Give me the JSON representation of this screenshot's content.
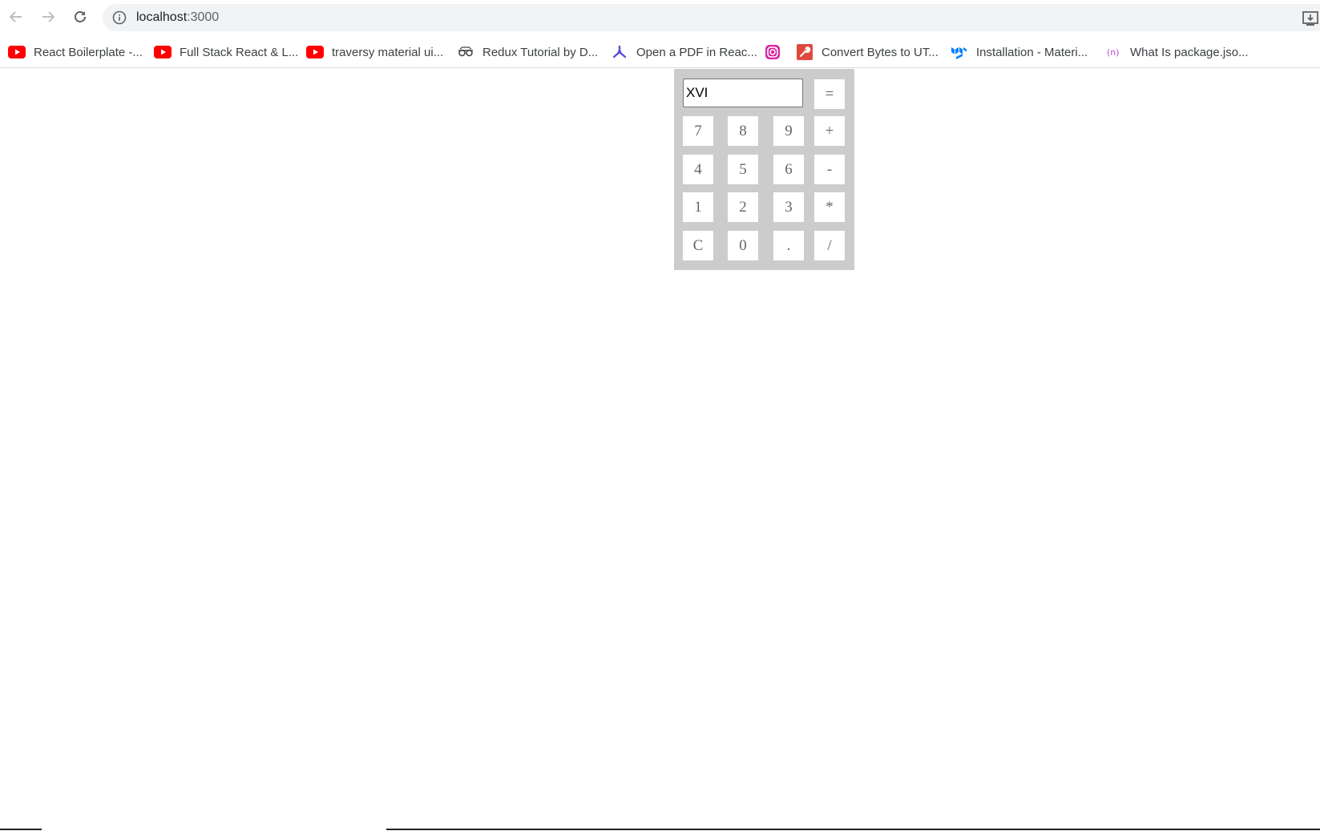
{
  "browser": {
    "url_host": "localhost",
    "url_port": ":3000",
    "bookmarks": [
      {
        "label": "React Boilerplate -...",
        "icon": "youtube-icon"
      },
      {
        "label": "Full Stack React & L...",
        "icon": "youtube-icon"
      },
      {
        "label": "traversy material ui...",
        "icon": "youtube-icon"
      },
      {
        "label": "Redux Tutorial by D...",
        "icon": "glasses-icon"
      },
      {
        "label": "Open a PDF in Reac...",
        "icon": "pspdfkit-icon"
      },
      {
        "label": "",
        "icon": "instagram-icon"
      },
      {
        "label": "Convert Bytes to UT...",
        "icon": "wrench-icon"
      },
      {
        "label": "Installation - Materi...",
        "icon": "mui-icon"
      },
      {
        "label": "What Is package.jso...",
        "icon": "nodejs-icon"
      }
    ]
  },
  "calculator": {
    "display_value": "XVI",
    "equals": "=",
    "keys": [
      "7",
      "8",
      "9",
      "+",
      "4",
      "5",
      "6",
      "-",
      "1",
      "2",
      "3",
      "*",
      "C",
      "0",
      ".",
      "/"
    ]
  },
  "colors": {
    "calculator_bg": "#cccccc",
    "key_bg": "#ffffff",
    "key_text": "#666666",
    "youtube_red": "#ff0000"
  }
}
